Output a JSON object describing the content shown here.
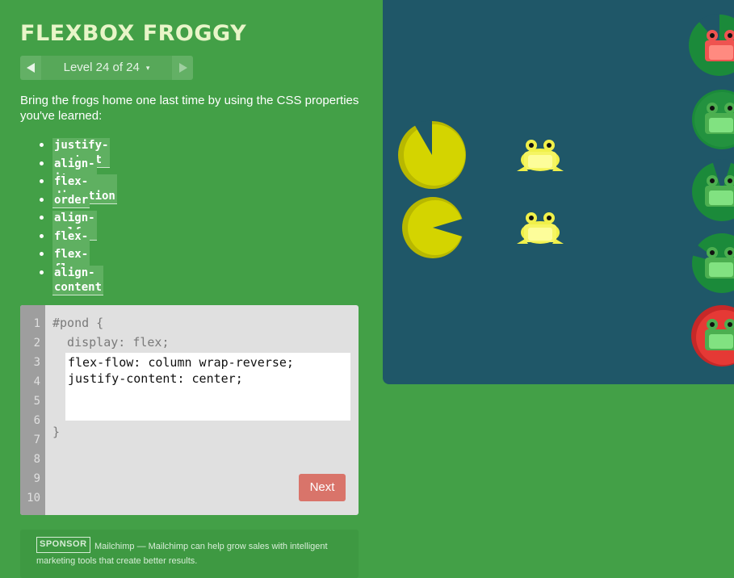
{
  "header": {
    "title": "FLEXBOX FROGGY"
  },
  "level_nav": {
    "label": "Level 24 of 24",
    "caret": "▾"
  },
  "instructions": {
    "text": "Bring the frogs home one last time by using the CSS properties you've learned:",
    "properties": [
      "justify-content",
      "align-items",
      "flex-direction",
      "order",
      "align-self",
      "flex-wrap",
      "flex-flow",
      "align-content"
    ]
  },
  "editor": {
    "line_numbers": [
      "1",
      "2",
      "3",
      "4",
      "5",
      "6",
      "7",
      "8",
      "9",
      "10"
    ],
    "line1": "#pond {",
    "line2": "  display: flex;",
    "input_value": "flex-flow: column wrap-reverse;\njustify-content: center;",
    "closing": "}",
    "next_label": "Next"
  },
  "sponsor": {
    "badge": "SPONSOR",
    "text": "Mailchimp — Mailchimp can help grow sales with intelligent marketing tools that create better results."
  },
  "pond": {
    "lilypads": [
      "yellow",
      "yellow",
      "red",
      "green",
      "green",
      "green",
      "red"
    ],
    "frogs": [
      "yellow",
      "yellow",
      "red",
      "green",
      "green",
      "green",
      "green"
    ]
  },
  "colors": {
    "background": "#43a047",
    "pond": "#1f5768",
    "next_button": "#d9746a",
    "yellow_pad": "#c8c800",
    "green_pad": "#1b8a3a",
    "red_pad": "#d32f2f"
  }
}
